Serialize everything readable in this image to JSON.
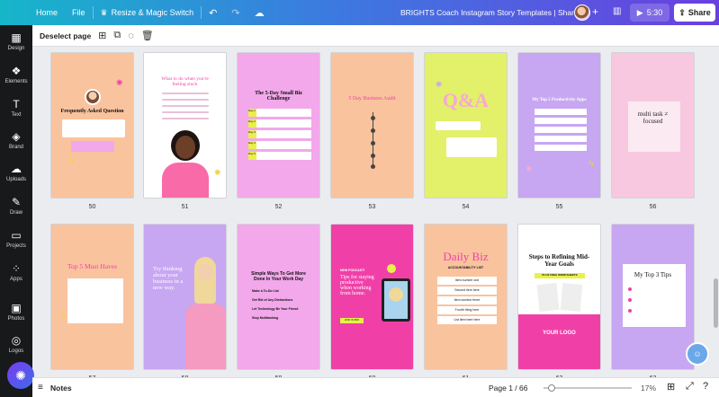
{
  "topbar": {
    "home": "Home",
    "file": "File",
    "resize": "Resize & Magic Switch",
    "doc_title": "BRIGHTS Coach Instagram Story Templates | Shared",
    "add": "+",
    "timer": "5:30",
    "share": "Share"
  },
  "sidebar": {
    "items": [
      {
        "label": "Design",
        "icon": "▦"
      },
      {
        "label": "Elements",
        "icon": "❖"
      },
      {
        "label": "Text",
        "icon": "T"
      },
      {
        "label": "Brand",
        "icon": "◈"
      },
      {
        "label": "Uploads",
        "icon": "☁"
      },
      {
        "label": "Draw",
        "icon": "✎"
      },
      {
        "label": "Projects",
        "icon": "▭"
      },
      {
        "label": "Apps",
        "icon": "⁘"
      },
      {
        "label": "Photos",
        "icon": "▣"
      },
      {
        "label": "Logos",
        "icon": "◎"
      }
    ]
  },
  "toolbar": {
    "deselect": "Deselect page"
  },
  "pages_row1": [
    {
      "num": "50",
      "bg": "#f9c39e",
      "title": "Frequently Asked Question"
    },
    {
      "num": "51",
      "bg": "#ffffff",
      "title": "What to do when you're feeling stuck"
    },
    {
      "num": "52",
      "bg": "#f2a8ea",
      "title": "The 5-Day Small Biz Challenge"
    },
    {
      "num": "53",
      "bg": "#f9c39e",
      "title": "5 Day Business Audit"
    },
    {
      "num": "54",
      "bg": "#e2f06a",
      "title": "Q&A"
    },
    {
      "num": "55",
      "bg": "#c7a6f2",
      "title": "My Top 5 Productivity Apps"
    },
    {
      "num": "56",
      "bg": "#f7c8e0",
      "title": "multi task ≠ focused"
    }
  ],
  "pages_row2": [
    {
      "num": "57",
      "bg": "#f9c39e",
      "title": "Top 5 Must Haves"
    },
    {
      "num": "58",
      "bg": "#c7a6f2",
      "title": "Try thinking about your business in a new way."
    },
    {
      "num": "59",
      "bg": "#f2a8ea",
      "title": "Simple Ways To Get More Done In Your Work Day"
    },
    {
      "num": "60",
      "bg": "#f040a8",
      "title": "Tips for staying productive when working from home."
    },
    {
      "num": "61",
      "bg": "#f9c39e",
      "title": "Daily Biz"
    },
    {
      "num": "62",
      "bg": "#ffffff",
      "title": "Steps to Refining Mid-Year Goals"
    },
    {
      "num": "63",
      "bg": "#c7a6f2",
      "title": "My Top 3 Tips"
    }
  ],
  "page52_items": [
    "Day 1",
    "Day 2",
    "Day 3",
    "Day 4",
    "Day 5"
  ],
  "page59_items": [
    "Make a To-Do List",
    "Get Rid of Any Distractions",
    "Let Technology Be Your Friend",
    "Stop Multitasking"
  ],
  "page61": {
    "subtitle": "ACCOUNTABILITY LIST",
    "items": [
      "Item number one",
      "Second item here",
      "Item number three",
      "Fourth thing here",
      "List item here here"
    ]
  },
  "page62": {
    "badge": "PLUS FREE WORKSHEETS",
    "logo": "YOUR LOGO"
  },
  "page60_tag": "NEW PODCAST!",
  "page60_cta": "LINK IN BIO",
  "bottombar": {
    "notes": "Notes",
    "page_indicator": "Page 1 / 66",
    "zoom": "17%"
  },
  "colors": {
    "accent": "#f040a8",
    "yellow": "#e9f04a",
    "dark": "#18191b"
  }
}
